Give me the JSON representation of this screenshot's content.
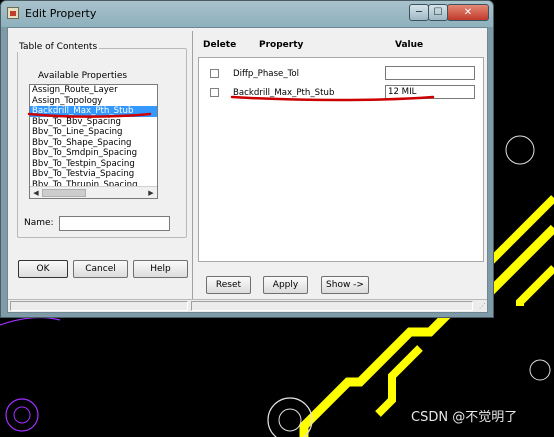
{
  "window": {
    "title": "Edit Property",
    "minimize_glyph": "─",
    "maximize_glyph": "☐",
    "close_glyph": "✕"
  },
  "left_panel": {
    "group_title": "Table of Contents",
    "available_label": "Available Properties",
    "available_properties": [
      "Assign_Route_Layer",
      "Assign_Topology",
      "Backdrill_Max_Pth_Stub",
      "Bbv_To_Bbv_Spacing",
      "Bbv_To_Line_Spacing",
      "Bbv_To_Shape_Spacing",
      "Bbv_To_Smdpin_Spacing",
      "Bbv_To_Testpin_Spacing",
      "Bbv_To_Testvia_Spacing",
      "Bbv_To_Thrupin_Spacing"
    ],
    "selected_index": 2,
    "name_label": "Name:",
    "name_value": "",
    "ok_label": "OK",
    "cancel_label": "Cancel",
    "help_label": "Help"
  },
  "right_panel": {
    "columns": {
      "delete": "Delete",
      "property": "Property",
      "value": "Value"
    },
    "rows": [
      {
        "property": "Diffp_Phase_Tol",
        "value": "",
        "delete": false
      },
      {
        "property": "Backdrill_Max_Pth_Stub",
        "value": "12 MIL",
        "delete": false
      }
    ],
    "reset_label": "Reset",
    "apply_label": "Apply",
    "show_label": "Show ->"
  },
  "watermark": "CSDN @不觉明了",
  "colors": {
    "selection": "#3399ff",
    "annotation_underline": "#cc0000",
    "trace_yellow": "#ffff00",
    "pad_purple": "#a030ff"
  }
}
